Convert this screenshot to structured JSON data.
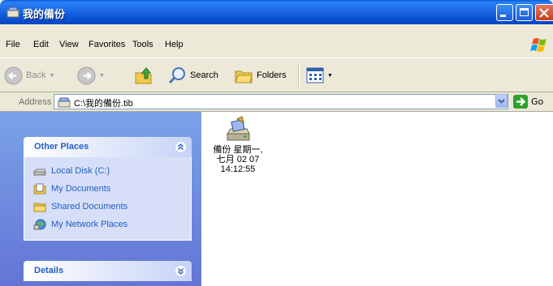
{
  "window": {
    "title": "我的備份",
    "icon": "backup-archive-icon"
  },
  "menubar": {
    "items": [
      "File",
      "Edit",
      "View",
      "Favorites",
      "Tools",
      "Help"
    ]
  },
  "toolbar": {
    "back_label": "Back",
    "search_label": "Search",
    "folders_label": "Folders"
  },
  "address": {
    "label": "Address",
    "value": "C:\\我的備份.tib",
    "go_label": "Go"
  },
  "sidebar": {
    "other_places_title": "Other Places",
    "places": [
      {
        "label": "Local Disk (C:)",
        "icon": "disk-drive-icon"
      },
      {
        "label": "My Documents",
        "icon": "my-documents-icon"
      },
      {
        "label": "Shared Documents",
        "icon": "shared-folder-icon"
      },
      {
        "label": "My Network Places",
        "icon": "network-places-icon"
      }
    ],
    "details_title": "Details"
  },
  "content": {
    "items": [
      {
        "name": "備份 星期一,\n七月 02 07\n14:12:55",
        "icon": "backup-file-icon"
      }
    ]
  },
  "colors": {
    "titlebar": "#0a4fd0",
    "sidebar_gradient_top": "#7ba2e7",
    "link_text": "#215dc6"
  }
}
